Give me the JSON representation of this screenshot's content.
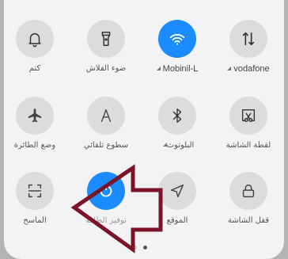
{
  "tiles": [
    {
      "id": "vodafone",
      "label": "vodafone",
      "icon": "data-transfer-icon",
      "active": false
    },
    {
      "id": "wifi",
      "label": "Mobinil-L",
      "icon": "wifi-icon",
      "active": true
    },
    {
      "id": "flashlight",
      "label": "ضوء الفلاش",
      "icon": "flashlight-icon",
      "active": false
    },
    {
      "id": "mute",
      "label": "كتم",
      "icon": "bell-icon",
      "active": false
    },
    {
      "id": "screenshot",
      "label": "لقطة الشاشة",
      "icon": "screenshot-scissors-icon",
      "active": false
    },
    {
      "id": "bluetooth",
      "label": "البلوتوث",
      "icon": "bluetooth-icon",
      "active": false
    },
    {
      "id": "auto-brightness",
      "label": "سطوع تلقائي",
      "icon": "auto-brightness-icon",
      "active": false
    },
    {
      "id": "airplane",
      "label": "وضع الطائرة",
      "icon": "airplane-icon",
      "active": false
    },
    {
      "id": "lock-screen",
      "label": "قفل الشاشة",
      "icon": "lock-icon",
      "active": false
    },
    {
      "id": "location",
      "label": "الموقع",
      "icon": "location-arrow-icon",
      "active": false
    },
    {
      "id": "power-saver",
      "label": "توفير الطاقة",
      "icon": "power-saver-icon",
      "active": true
    },
    {
      "id": "scanner",
      "label": "الماسح",
      "icon": "scanner-icon",
      "active": false
    }
  ],
  "pagination": {
    "pages": 2,
    "current": 2
  },
  "annotation": {
    "type": "arrow",
    "color": "#7a1426",
    "points_to": "power-saver"
  },
  "colors": {
    "accent": "#1a8cff",
    "tile_bg": "#dcdcdf",
    "panel_bg": "#f3f3f5"
  }
}
